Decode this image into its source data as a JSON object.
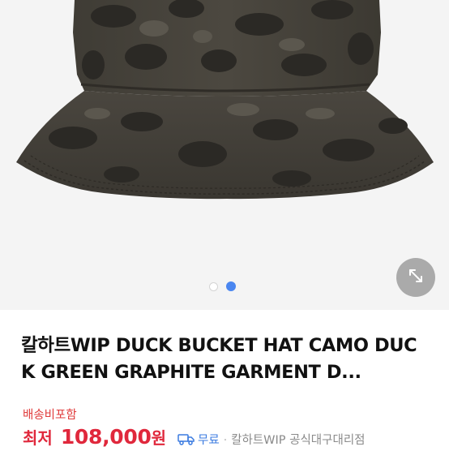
{
  "gallery": {
    "image_alt": "DUCK BUCKET HAT CAMO",
    "total_slides": 2,
    "active_slide": 2,
    "expand_icon": "expand-arrows-icon",
    "colors": {
      "active_dot": "#4a86f0",
      "inactive_dot": "#ffffff"
    }
  },
  "product": {
    "title": "칼하트WIP DUCK BUCKET HAT CAMO DUCK GREEN GRAPHITE GARMENT D...",
    "shipping_note": "배송비포함",
    "price_prefix": "최저",
    "price": "108,000",
    "price_unit": "원",
    "delivery_icon": "truck-icon",
    "delivery": "무료",
    "separator": "·",
    "seller": "칼하트WIP 공식대구대리점"
  },
  "colors": {
    "price": "#e0283c",
    "free_delivery": "#3b7be0",
    "seller_text": "#8a8a8a"
  }
}
